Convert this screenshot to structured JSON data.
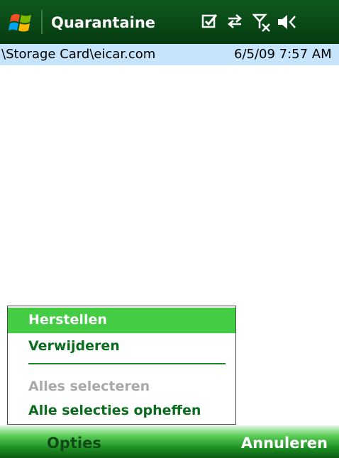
{
  "titlebar": {
    "title": "Quarantaine",
    "icons": [
      "windows-start-icon",
      "tasks-checkbox-icon",
      "connectivity-arrows-icon",
      "signal-off-icon",
      "speaker-icon"
    ]
  },
  "list": {
    "rows": [
      {
        "path": "\\Storage Card\\eicar.com",
        "date": "6/5/09 7:57 AM"
      }
    ]
  },
  "menu": {
    "items": [
      {
        "label": "Herstellen",
        "state": "selected"
      },
      {
        "label": "Verwijderen",
        "state": "enabled"
      },
      {
        "label": "Alles selecteren",
        "state": "disabled"
      },
      {
        "label": "Alle selecties opheffen",
        "state": "enabled"
      }
    ]
  },
  "softkeys": {
    "left": "Opties",
    "right": "Annuleren"
  },
  "colors": {
    "titlebar": "#0a4a18",
    "selection": "#c6e4fb",
    "menu_highlight": "#44cc44",
    "menu_text": "#0b6b1e"
  }
}
